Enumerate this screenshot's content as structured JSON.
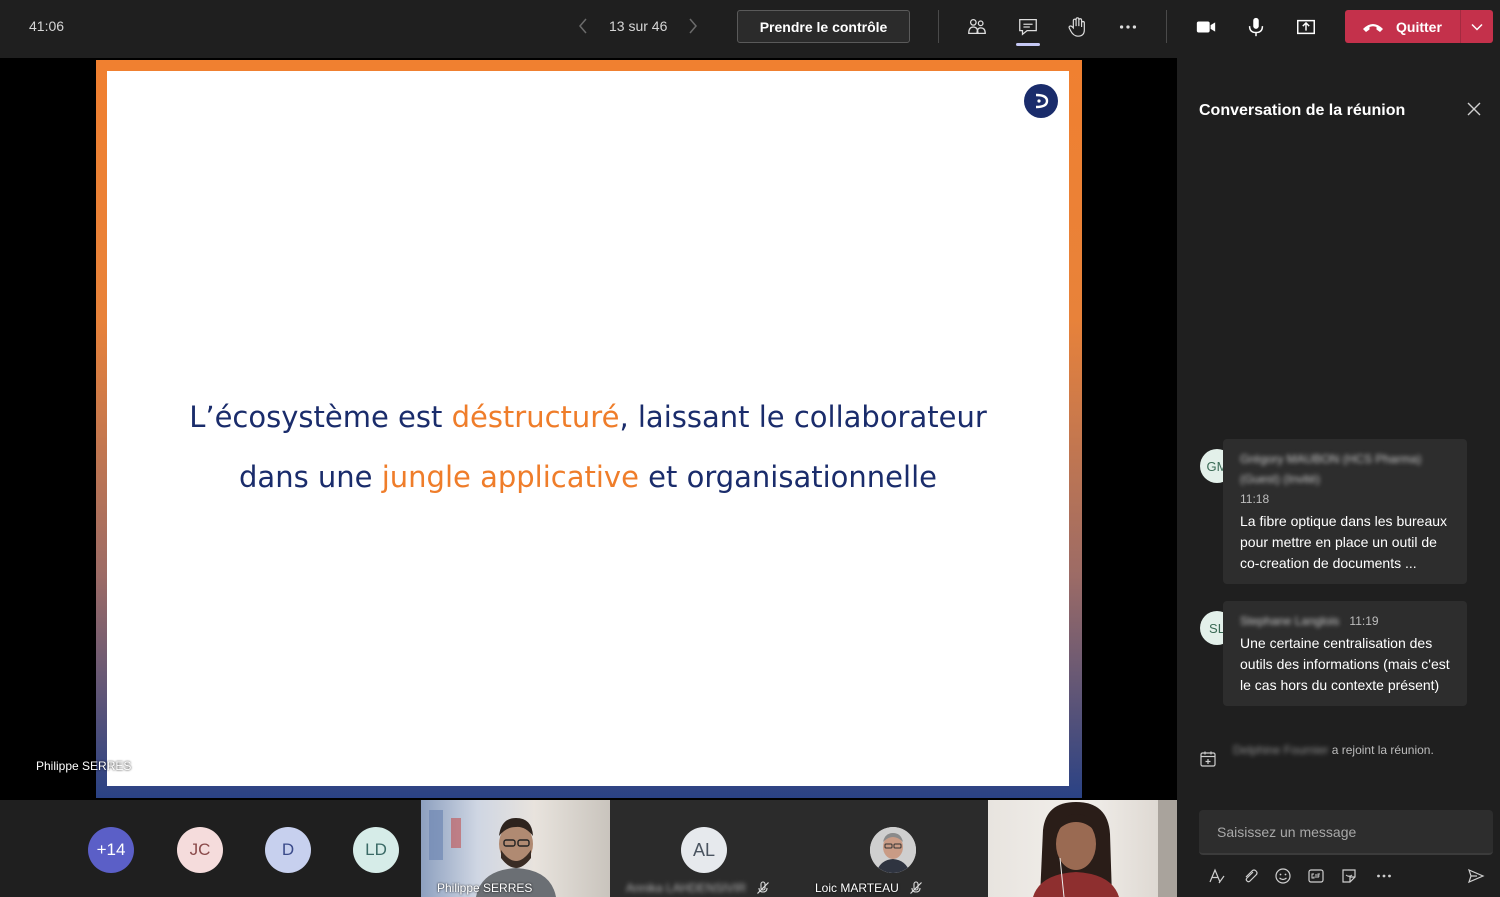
{
  "topbar": {
    "timer": "41:06",
    "pager_text": "13 sur 46",
    "take_control_label": "Prendre le contrôle",
    "leave_label": "Quitter",
    "leave_color": "#c4314b"
  },
  "slide": {
    "line1_part1": "L’écosystème est ",
    "line1_highlight": "déstructuré",
    "line1_part2": ", laissant le collaborateur",
    "line2_part1": "dans une ",
    "line2_highlight": "jungle applicative",
    "line2_part2": " et organisationnelle",
    "text_color": "#1a2c6b",
    "highlight_color": "#ef7d2a"
  },
  "stage": {
    "presenter_name": "Philippe SERRES"
  },
  "participants": [
    {
      "initials": "+14",
      "bg": "#5b5fc7",
      "fg": "#ffffff"
    },
    {
      "initials": "JC",
      "bg": "#f5dcdc",
      "fg": "#8a4a4a"
    },
    {
      "initials": "D",
      "bg": "#c7d0ee",
      "fg": "#3a4a8a"
    },
    {
      "initials": "LD",
      "bg": "#d6ece8",
      "fg": "#3a6a66"
    }
  ],
  "tiles": {
    "philippe_name": "Philippe SERRES",
    "al_initials": "AL",
    "al_name": "Annika LAHDENSIVIR",
    "loic_name": "Loic MARTEAU"
  },
  "chat": {
    "title": "Conversation de la réunion",
    "messages": [
      {
        "initials": "GM",
        "sender": "Grégory MAUBON (HCS Pharma) (Guest) (Invité)",
        "time": "11:18",
        "text": "La fibre optique dans les bureaux pour mettre en place un outil de co-creation de documents ...",
        "presence_color": "#ffffff"
      },
      {
        "initials": "SL",
        "sender": "Stephane Langlois",
        "time": "11:19",
        "text": "Une certaine centralisation des outils des informations (mais c'est le cas hors du contexte présent)",
        "presence_color": "#d13438"
      }
    ],
    "system_name": "Delphine Fournier",
    "system_text": " a rejoint la réunion.",
    "compose_placeholder": "Saisissez un message"
  }
}
